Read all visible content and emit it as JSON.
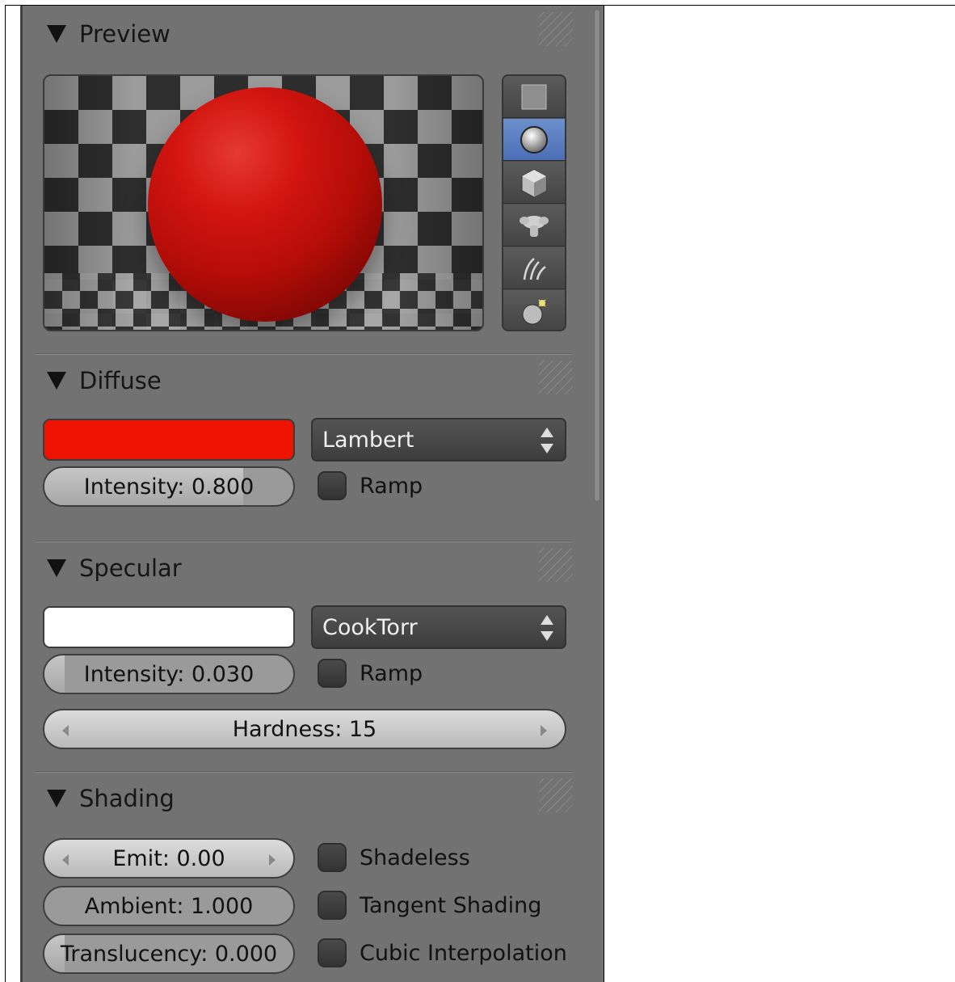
{
  "panels": {
    "preview": {
      "title": "Preview",
      "shapes": [
        "flat-plane-icon",
        "sphere-icon",
        "cube-icon",
        "monkey-icon",
        "hair-strands-icon",
        "sphere-on-cube-icon"
      ],
      "active_shape": "sphere-icon",
      "material_color": "#d2150f"
    },
    "diffuse": {
      "title": "Diffuse",
      "color": "#ee1200",
      "shader": "Lambert",
      "intensity_label": "Intensity: 0.800",
      "intensity_value": 0.8,
      "ramp_label": "Ramp"
    },
    "specular": {
      "title": "Specular",
      "color": "#ffffff",
      "shader": "CookTorr",
      "intensity_label": "Intensity: 0.030",
      "intensity_value": 0.03,
      "ramp_label": "Ramp",
      "hardness_label": "Hardness: 15"
    },
    "shading": {
      "title": "Shading",
      "emit_label": "Emit: 0.00",
      "ambient_label": "Ambient: 1.000",
      "ambient_value": 1.0,
      "translucency_label": "Translucency: 0.000",
      "translucency_value": 0.0,
      "shadeless_label": "Shadeless",
      "tangent_label": "Tangent Shading",
      "cubic_label": "Cubic Interpolation"
    }
  },
  "colors": {
    "panel_bg": "#727272",
    "active_blue": "#5a7fc2"
  }
}
